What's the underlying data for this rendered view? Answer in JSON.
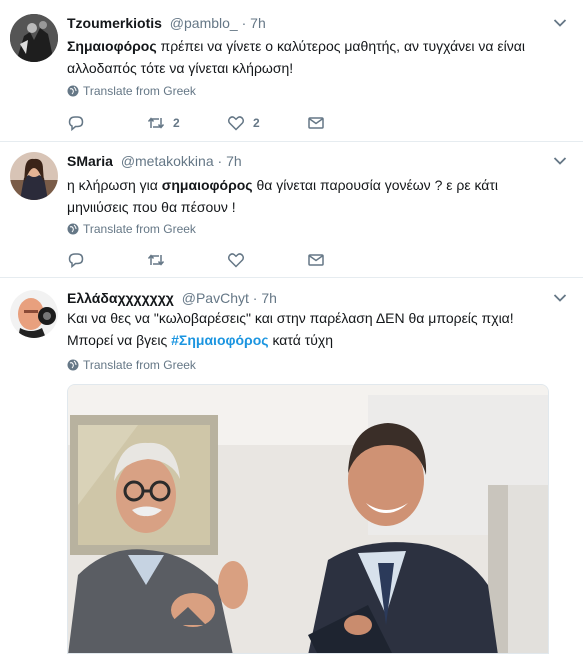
{
  "tweets": [
    {
      "name": "Tzoumerkiotis",
      "handle": "@pamblo_",
      "separator": "·",
      "time": "7h",
      "text_bold": "Σημαιοφόρος",
      "text_rest": " πρέπει να γίνετε ο καλύτερος μαθητής, αν τυγχάνει να είναι αλλοδαπός τότε να γίνεται κλήρωση!",
      "translate": "Translate from Greek",
      "reply_count": "",
      "retweet_count": "2",
      "like_count": "2"
    },
    {
      "name": "SMaria",
      "handle": "@metakokkina",
      "separator": "·",
      "time": "7h",
      "text_pre": "η κλήρωση για ",
      "text_bold": "σημαιοφόρος",
      "text_rest": " θα γίνεται παρουσία γονέων ? ε ρε κάτι μηνιιύσεις που θα πέσουν !",
      "translate": "Translate from Greek",
      "reply_count": "",
      "retweet_count": "",
      "like_count": ""
    },
    {
      "name": "Ελλάδαχχχχχχχ",
      "handle": "@PavChyt",
      "separator": "·",
      "time": "7h",
      "text_line1": "Και να θες να \"κωλοβαρέσεις\" και στην παρέλαση ΔΕΝ θα μπορείς πχια!",
      "text_line2_pre": "Μπορεί να βγεις ",
      "hashtag": "#Σημαιοφόρος",
      "text_line2_post": " κατά τύχη",
      "translate": "Translate from Greek"
    }
  ],
  "colors": {
    "text": "#14171a",
    "muted": "#657786",
    "link": "#1b95e0",
    "divider": "#e6ecf0"
  },
  "icons": [
    "reply-icon",
    "retweet-icon",
    "like-icon",
    "direct-message-icon",
    "globe-icon",
    "chevron-down-icon"
  ]
}
